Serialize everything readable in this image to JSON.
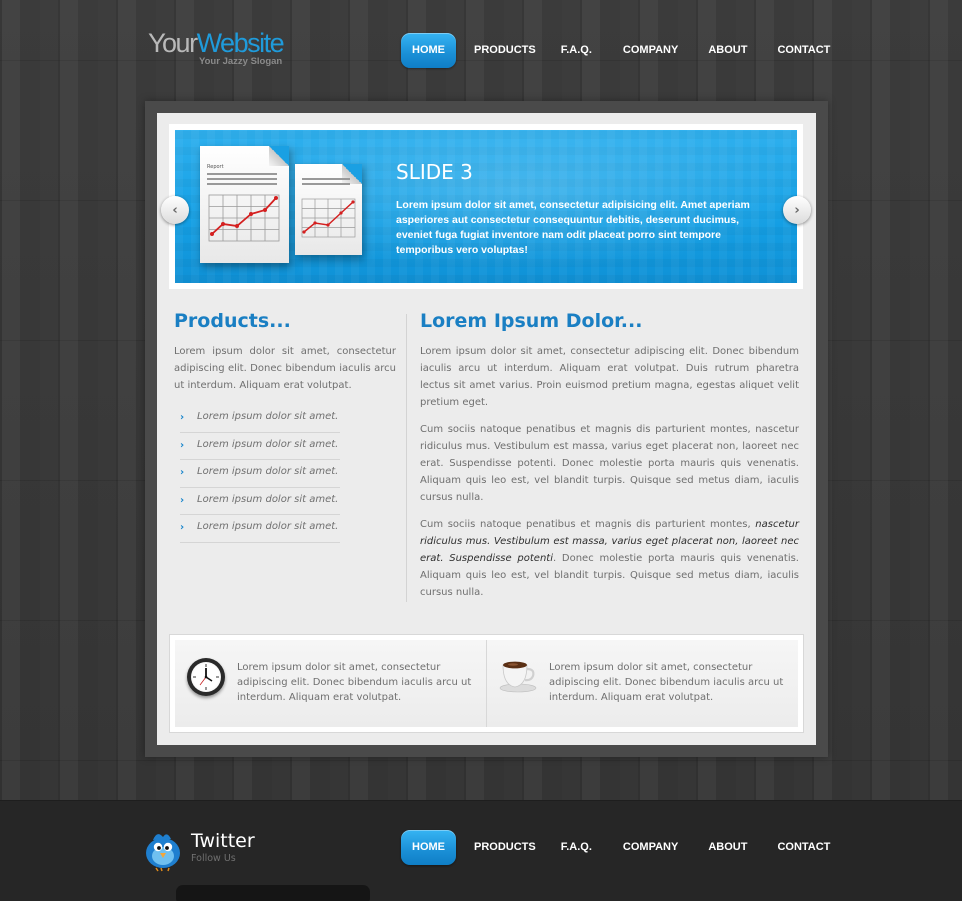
{
  "header": {
    "logo_part1": "Your",
    "logo_part2": "Website",
    "slogan": "Your Jazzy Slogan"
  },
  "nav": {
    "items": [
      {
        "label": "HOME",
        "active": true
      },
      {
        "label": "PRODUCTS",
        "active": false
      },
      {
        "label": "F.A.Q.",
        "active": false
      },
      {
        "label": "COMPANY",
        "active": false
      },
      {
        "label": "ABOUT",
        "active": false
      },
      {
        "label": "CONTACT",
        "active": false
      }
    ]
  },
  "slider": {
    "title": "SLIDE 3",
    "text": "Lorem ipsum dolor sit amet, consectetur adipisicing elit. Amet aperiam asperiores aut consectetur consequuntur debitis, deserunt ducimus, eveniet fuga fugiat inventore nam odit placeat porro sint tempore temporibus vero voluptas!",
    "doc_title": "Report",
    "prev_icon": "chevron-left-icon",
    "next_icon": "chevron-right-icon"
  },
  "products": {
    "heading": "Products...",
    "intro": "Lorem ipsum dolor sit amet, consectetur adipiscing elit. Donec bibendum iaculis arcu ut interdum. Aliquam erat volutpat.",
    "items": [
      "Lorem ipsum dolor sit amet.",
      "Lorem ipsum dolor sit amet.",
      "Lorem ipsum dolor sit amet.",
      "Lorem ipsum dolor sit amet.",
      "Lorem ipsum dolor sit amet."
    ],
    "bullet": "›"
  },
  "lorem": {
    "heading": "Lorem Ipsum Dolor...",
    "para1": "Lorem ipsum dolor sit amet, consectetur adipiscing elit. Donec bibendum iaculis arcu ut interdum. Aliquam erat volutpat. Duis rutrum pharetra lectus sit amet varius. Proin euismod pretium magna, egestas aliquet velit pretium eget.",
    "para2": "Cum sociis natoque penatibus et magnis dis parturient montes, nascetur ridiculus mus. Vestibulum est massa, varius eget placerat non, laoreet nec erat. Suspendisse potenti. Donec molestie porta mauris quis venenatis. Aliquam quis leo est, vel blandit turpis. Quisque sed metus diam, iaculis cursus nulla.",
    "para3_start": "Cum sociis natoque penatibus et magnis dis parturient montes, ",
    "para3_em": "nascetur ridiculus mus. Vestibulum est massa, varius eget placerat non, laoreet nec erat. Suspendisse potenti",
    "para3_end": ". Donec molestie porta mauris quis venenatis. Aliquam quis leo est, vel blandit turpis. Quisque sed metus diam, iaculis cursus nulla."
  },
  "features": [
    {
      "icon": "clock-icon",
      "text": "Lorem ipsum dolor sit amet, consectetur adipiscing elit. Donec bibendum iaculis arcu ut interdum. Aliquam erat volutpat."
    },
    {
      "icon": "coffee-cup-icon",
      "text": "Lorem ipsum dolor sit amet, consectetur adipiscing elit. Donec bibendum iaculis arcu ut interdum. Aliquam erat volutpat."
    }
  ],
  "footer": {
    "twitter_title": "Twitter",
    "twitter_sub": "Follow Us",
    "icon": "twitter-bird-icon"
  },
  "colors": {
    "accent": "#1a7fc3",
    "nav_active": "#1a8fd6",
    "slide_bg": "#15a1e6",
    "panel_bg": "#ececec",
    "footer_bg": "#262626"
  }
}
